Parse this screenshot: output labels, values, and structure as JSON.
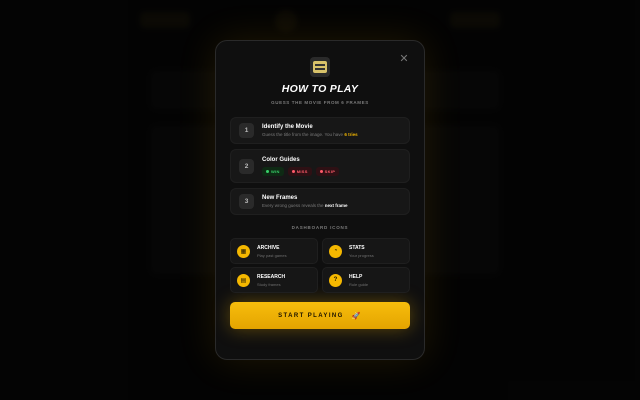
{
  "modal": {
    "close_symbol": "✕",
    "logo_icon": "clapperboard-icon",
    "title": "HOW TO PLAY",
    "subtitle": "GUESS THE MOVIE FROM 6 FRAMES",
    "steps": [
      {
        "number": "1",
        "title": "Identify the Movie",
        "desc_prefix": "Guess the title from the image. You have ",
        "desc_highlight": "6 tries"
      },
      {
        "number": "2",
        "title": "Color Guides",
        "chips": [
          {
            "label": "WIN",
            "color": "#38d16a"
          },
          {
            "label": "MISS",
            "color": "#ff5a6a"
          },
          {
            "label": "SKIP",
            "color": "#ff5a6a"
          }
        ]
      },
      {
        "number": "3",
        "title": "New Frames",
        "desc_prefix": "Every wrong guess reveals the ",
        "desc_highlight": "next frame"
      }
    ],
    "section_label": "DASHBOARD ICONS",
    "icons": [
      {
        "title": "ARCHIVE",
        "desc": "Play past games",
        "icon": "calendar-icon",
        "glyph": "▦"
      },
      {
        "title": "STATS",
        "desc": "Your progress",
        "icon": "stats-icon",
        "glyph": "◔"
      },
      {
        "title": "RESEARCH",
        "desc": "Study frames",
        "icon": "book-icon",
        "glyph": "▤"
      },
      {
        "title": "HELP",
        "desc": "Rule guide",
        "icon": "help-icon",
        "glyph": "?"
      }
    ],
    "start_button": {
      "label": "START PLAYING",
      "icon": "rocket-icon",
      "glyph": "🚀"
    }
  },
  "colors": {
    "accent": "#f5b800",
    "win": "#38d16a",
    "miss": "#ff5a6a",
    "background": "#080808",
    "modal_bg": "#0f0f0f"
  }
}
